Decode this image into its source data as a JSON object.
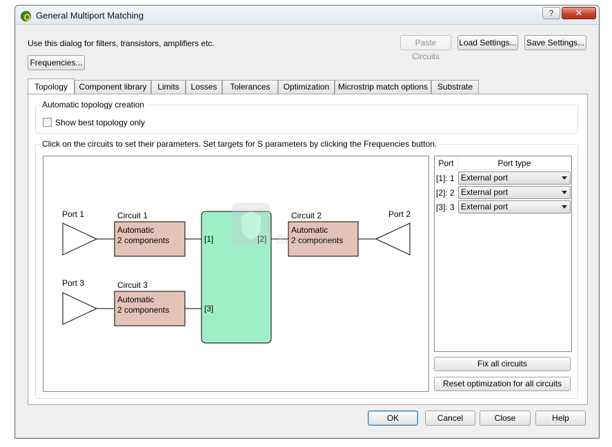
{
  "window": {
    "title": "General Multiport Matching",
    "help_label": "?",
    "close_label": "✕"
  },
  "header": {
    "intro_text": "Use this dialog for filters, transistors, amplifiers etc.",
    "paste_circuits_label": "Paste Circuits",
    "load_settings_label": "Load Settings...",
    "save_settings_label": "Save Settings...",
    "frequencies_label": "Frequencies..."
  },
  "tabs": [
    {
      "label": "Topology",
      "active": true
    },
    {
      "label": "Component library",
      "active": false
    },
    {
      "label": "Limits",
      "active": false
    },
    {
      "label": "Losses",
      "active": false
    },
    {
      "label": "Tolerances",
      "active": false
    },
    {
      "label": "Optimization",
      "active": false
    },
    {
      "label": "Microstrip match options",
      "active": false
    },
    {
      "label": "Substrate",
      "active": false
    }
  ],
  "topology": {
    "group_title": "Automatic topology creation",
    "show_best_label": "Show best topology only",
    "show_best_checked": false,
    "instructions": "Click on the circuits to set their parameters.  Set targets for S parameters by clicking the Frequencies button."
  },
  "schematic": {
    "port1_label": "Port 1",
    "port2_label": "Port 2",
    "port3_label": "Port 3",
    "circuit1": {
      "title": "Circuit 1",
      "line1": "Automatic",
      "line2": "2 components"
    },
    "circuit2": {
      "title": "Circuit 2",
      "line1": "Automatic",
      "line2": "2 components"
    },
    "circuit3": {
      "title": "Circuit 3",
      "line1": "Automatic",
      "line2": "2 components"
    },
    "node1_label": "[1]",
    "node2_label": "[2]",
    "node3_label": "[3]",
    "colors": {
      "circuit_fill": "#e5c2b8",
      "hub_fill": "#9ff0c9"
    }
  },
  "port_table": {
    "col_port": "Port",
    "col_type": "Port type",
    "rows": [
      {
        "port": "[1]: 1",
        "type": "External port"
      },
      {
        "port": "[2]: 2",
        "type": "External port"
      },
      {
        "port": "[3]: 3",
        "type": "External port"
      }
    ],
    "fix_all_label": "Fix all circuits",
    "reset_label": "Reset optimization for all circuits"
  },
  "footer": {
    "ok_label": "OK",
    "cancel_label": "Cancel",
    "close_label": "Close",
    "help_label": "Help"
  },
  "watermark": {
    "text": "anxz.com"
  }
}
